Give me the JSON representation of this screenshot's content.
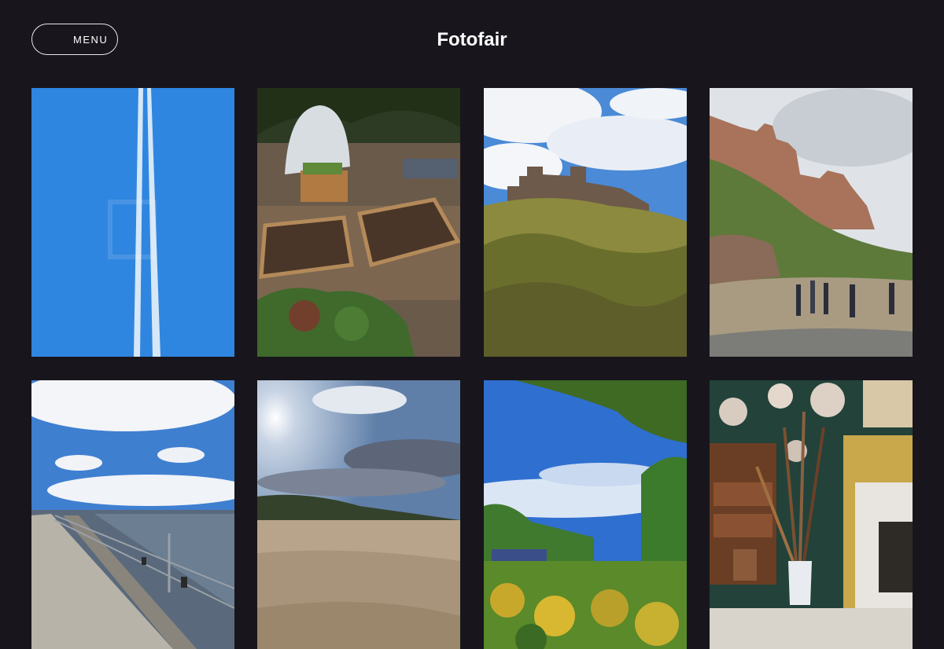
{
  "site": {
    "title": "Fotofair",
    "menu_label": "MENU"
  },
  "colors": {
    "background": "#18161c",
    "text": "#ffffff",
    "button_border": "#e8e6ee"
  },
  "photos": [
    {
      "id": "contrails-sky"
    },
    {
      "id": "allotment-greenhouse"
    },
    {
      "id": "castle-dunes"
    },
    {
      "id": "castle-cliff-walkers"
    },
    {
      "id": "pier-railing-sea"
    },
    {
      "id": "sunny-beach"
    },
    {
      "id": "allotment-trees-sky"
    },
    {
      "id": "fireplace-brushes"
    }
  ]
}
